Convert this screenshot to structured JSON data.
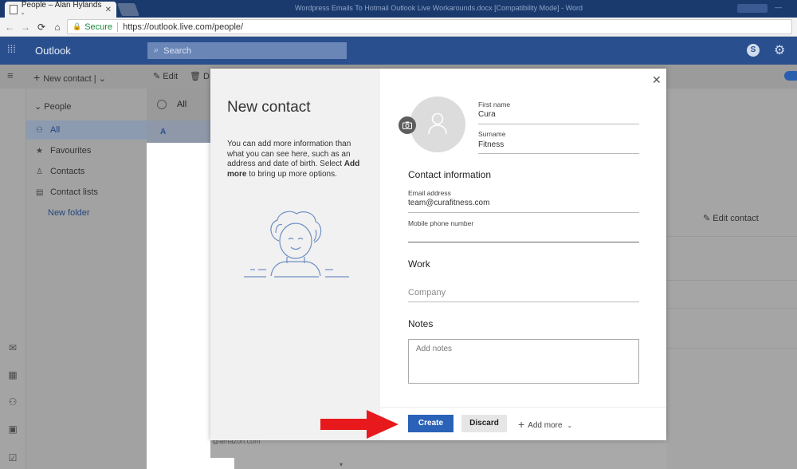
{
  "browser": {
    "tab_title": "People – Alan Hylands - ",
    "tab_close": "✕",
    "window_title": "Wordpress Emails To Hotmail Outlook Live Workarounds.docx [Compatibility Mode] - Word",
    "secure_label": "Secure",
    "url": "https://outlook.live.com/people/"
  },
  "outlook": {
    "app_title": "Outlook",
    "search_placeholder": "Search",
    "skype_label": "S"
  },
  "commands": {
    "new_contact": "New contact",
    "edit": "Edit",
    "delete": "D"
  },
  "nav": {
    "header": "People",
    "items": [
      {
        "label": "All",
        "icon": "people-icon"
      },
      {
        "label": "Favourites",
        "icon": "star-icon"
      },
      {
        "label": "Contacts",
        "icon": "person-icon"
      },
      {
        "label": "Contact lists",
        "icon": "list-icon"
      }
    ],
    "new_folder": "New folder"
  },
  "list": {
    "all_label": "All",
    "letter": "A",
    "partial_text": "@amazon.com"
  },
  "detail": {
    "edit_contact": "Edit contact"
  },
  "modal": {
    "title": "New contact",
    "description_1": "You can add more information than what you can see here, such as an address and date of birth. Select ",
    "description_bold": "Add more",
    "description_2": " to bring up more options.",
    "close": "✕",
    "first_name_label": "First name",
    "first_name_value": "Cura",
    "surname_label": "Surname",
    "surname_value": "Fitness",
    "contact_info_heading": "Contact information",
    "email_label": "Email address",
    "email_value": "team@curafitness.com",
    "mobile_label": "Mobile phone number",
    "mobile_value": "",
    "work_heading": "Work",
    "company_placeholder": "Company",
    "notes_heading": "Notes",
    "notes_placeholder": "Add notes",
    "create_button": "Create",
    "discard_button": "Discard",
    "add_more_button": "Add more"
  },
  "colors": {
    "outlook_blue": "#2a4f8e",
    "primary_button": "#2a62b8",
    "arrow_red": "#e8191c"
  }
}
